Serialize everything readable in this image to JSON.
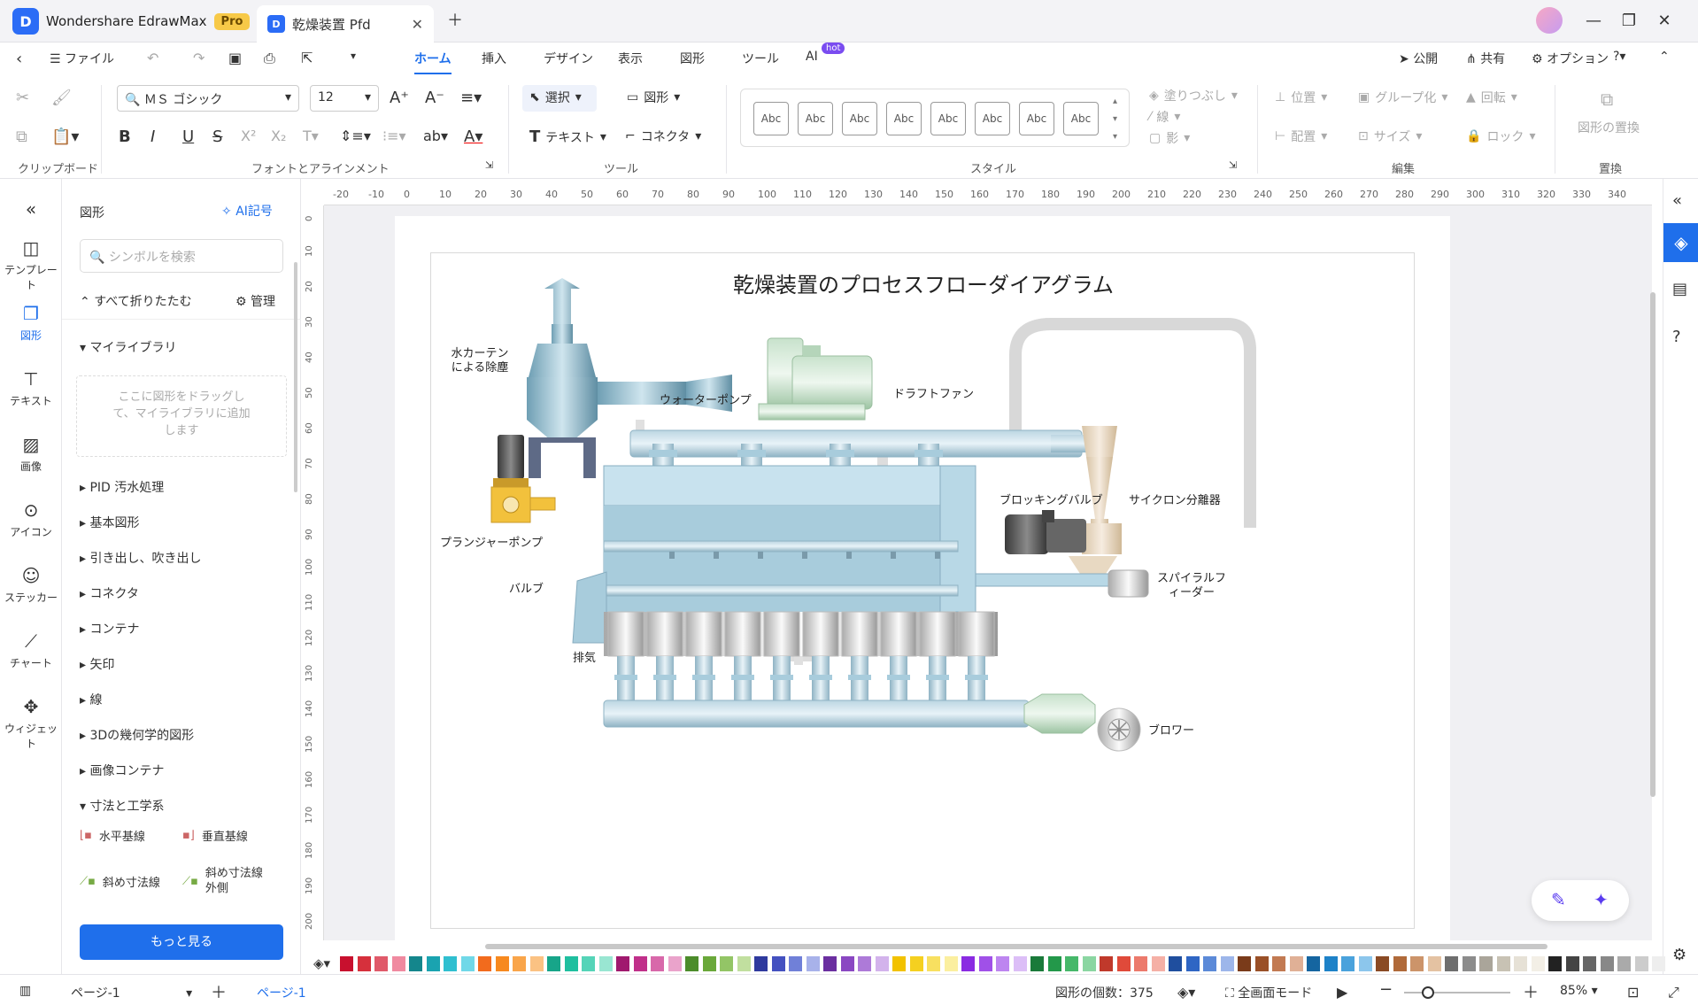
{
  "app": {
    "name": "Wondershare EdrawMax",
    "badge": "Pro"
  },
  "doc_tab": {
    "title": "乾燥装置 Pfd"
  },
  "menu": {
    "file": "ファイル",
    "tabs": [
      "ホーム",
      "挿入",
      "デザイン",
      "表示",
      "図形",
      "ツール",
      "AI"
    ],
    "ai_badge": "hot",
    "publish": "公開",
    "share": "共有",
    "options": "オプション"
  },
  "ribbon": {
    "font_name": "ＭＳ ゴシック",
    "font_size": "12",
    "select": "選択",
    "shape": "図形",
    "text": "テキスト",
    "connector": "コネクタ",
    "style_sample": "Abc",
    "fill": "塗りつぶし",
    "line": "線",
    "shadow": "影",
    "position": "位置",
    "group": "グループ化",
    "rotate": "回転",
    "align": "配置",
    "size": "サイズ",
    "lock": "ロック",
    "replace_shape": "図形の置換",
    "groups": [
      "クリップボード",
      "フォントとアラインメント",
      "ツール",
      "スタイル",
      "編集",
      "置換"
    ]
  },
  "leftnav": [
    "テンプレート",
    "図形",
    "テキスト",
    "画像",
    "アイコン",
    "ステッカー",
    "チャート",
    "ウィジェット"
  ],
  "panel": {
    "title": "図形",
    "ai_symbol": "AI記号",
    "search_placeholder": "シンボルを検索",
    "collapse_all": "すべて折りたたむ",
    "manage": "管理",
    "my_library": "マイライブラリ",
    "drop_hint": "ここに図形をドラッグして、マイライブラリに追加します",
    "libraries": [
      "PID 汚水処理",
      "基本図形",
      "引き出し、吹き出し",
      "コネクタ",
      "コンテナ",
      "矢印",
      "線",
      "3Dの幾何学的図形",
      "画像コンテナ",
      "寸法と工学系"
    ],
    "dims": [
      "水平基線",
      "垂直基線",
      "斜め寸法線",
      "斜め寸法線外側"
    ],
    "more": "もっと見る"
  },
  "ruler_h": [
    "-20",
    "-10",
    "0",
    "10",
    "20",
    "30",
    "40",
    "50",
    "60",
    "70",
    "80",
    "90",
    "100",
    "110",
    "120",
    "130",
    "140",
    "150",
    "160",
    "170",
    "180",
    "190",
    "200",
    "210",
    "220",
    "230",
    "240",
    "250",
    "260",
    "270",
    "280",
    "290",
    "300",
    "310",
    "320",
    "330",
    "340"
  ],
  "ruler_v": [
    "0",
    "10",
    "20",
    "30",
    "40",
    "50",
    "60",
    "70",
    "80",
    "90",
    "100",
    "110",
    "120",
    "130",
    "140",
    "150",
    "160",
    "170",
    "180",
    "190",
    "200"
  ],
  "diagram": {
    "title": "乾燥装置のプロセスフローダイアグラム",
    "labels": {
      "water_curtain": "水カーテンによる除塵",
      "water_pump": "ウォーターポンプ",
      "draft_fan": "ドラフトファン",
      "blocking_valve": "ブロッキングバルブ",
      "cyclone": "サイクロン分離器",
      "plunger_pump": "プランジャーポンプ",
      "valve": "バルブ",
      "spiral_feeder": "スパイラルフィーダー",
      "exhaust": "排気",
      "blower": "ブロワー"
    }
  },
  "palette": [
    "#c8102e",
    "#d6303c",
    "#e05a6a",
    "#f08aa0",
    "#14868c",
    "#1aa3b0",
    "#30bfd0",
    "#70d8e8",
    "#f26b1d",
    "#f7891f",
    "#f9a54a",
    "#fbc283",
    "#17a589",
    "#1fbf9f",
    "#55d4b8",
    "#99e6d2",
    "#a0196e",
    "#c0308a",
    "#d868aa",
    "#eaa3cb",
    "#4c8c2b",
    "#6aa83a",
    "#93c566",
    "#c1df9f",
    "#2f3a9e",
    "#4451c0",
    "#7080d8",
    "#a8b2ea",
    "#6b2fa0",
    "#8a48c2",
    "#ad7ad8",
    "#d3b3ec",
    "#f2c200",
    "#f5d020",
    "#f8e060",
    "#fbef9f",
    "#8a2be2",
    "#a050e8",
    "#bd85f0",
    "#dcbef7",
    "#1a7a3a",
    "#23984a",
    "#46b86a",
    "#8bd6a2",
    "#c0392b",
    "#e04a3a",
    "#ec7a6c",
    "#f5b0a6",
    "#1f4e9e",
    "#2f66c4",
    "#5c8ad8",
    "#9db6ea",
    "#7a3b1a",
    "#9a5028",
    "#c27a52",
    "#e0b096",
    "#1565a0",
    "#1e82c8",
    "#4aa2dc",
    "#8cc6ec",
    "#8a4a24",
    "#b06a3a",
    "#cc946a",
    "#e4c2a2",
    "#6e6e6e",
    "#8c8c8c",
    "#aaa59a",
    "#c8c2b4",
    "#e6e1d6",
    "#f3efe6",
    "#222222",
    "#444444",
    "#666666",
    "#888888",
    "#aaaaaa",
    "#cccccc",
    "#eeeeee"
  ],
  "status": {
    "page_sel": "ページ-1",
    "page_tab": "ページ-1",
    "shape_count": "図形の個数：375",
    "fullscreen": "全画面モード",
    "zoom": "85%"
  }
}
